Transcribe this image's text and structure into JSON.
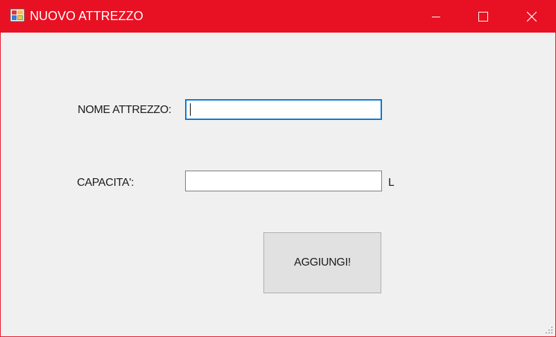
{
  "window": {
    "title": "NUOVO ATTREZZO",
    "accent_color": "#e81123",
    "title_text_color": "#ffffff",
    "background_color": "#f0f0f0"
  },
  "caption_buttons": {
    "minimize_icon": "minimize-icon",
    "maximize_icon": "maximize-icon",
    "close_icon": "close-icon"
  },
  "form": {
    "name_label": "NOME ATTREZZO:",
    "name_value": "",
    "capacity_label": "CAPACITA':",
    "capacity_value": "",
    "capacity_unit": "L",
    "submit_label": "AGGIUNGI!",
    "focus_color": "#0078d7"
  }
}
